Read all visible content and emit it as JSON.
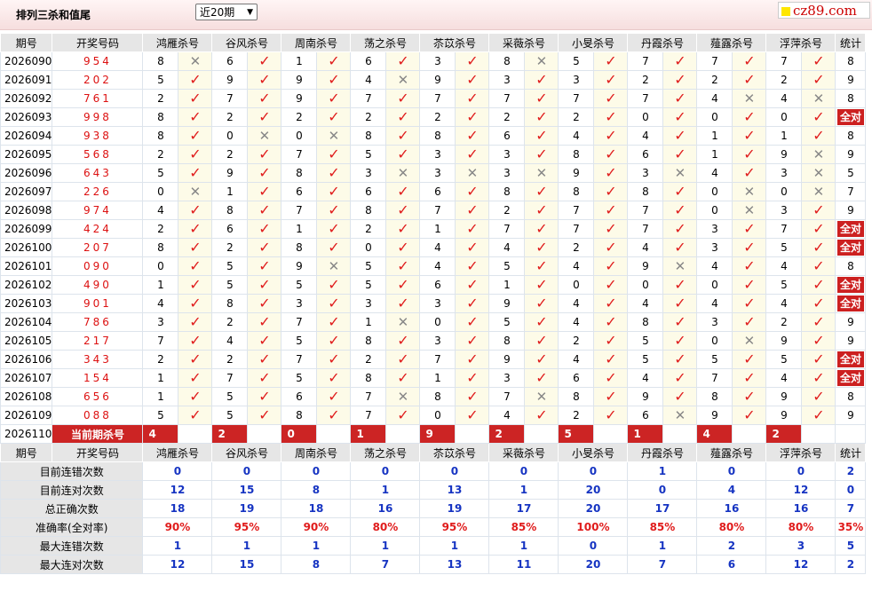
{
  "topbar": {
    "title": "排列三杀和值尾",
    "range_select": "近20期",
    "logo_text": "cz89.com"
  },
  "header": {
    "period": "期号",
    "code": "开奖号码",
    "experts": [
      "鸿雁杀号",
      "谷风杀号",
      "周南杀号",
      "荡之杀号",
      "苶苡杀号",
      "采薇杀号",
      "小旻杀号",
      "丹霞杀号",
      "薤露杀号",
      "浮萍杀号"
    ],
    "stat": "统计"
  },
  "rows": [
    {
      "period": "2026090",
      "code": "954",
      "cells": [
        [
          8,
          0
        ],
        [
          6,
          1
        ],
        [
          1,
          1
        ],
        [
          6,
          1
        ],
        [
          3,
          1
        ],
        [
          8,
          0
        ],
        [
          5,
          1
        ],
        [
          7,
          1
        ],
        [
          7,
          1
        ],
        [
          7,
          1
        ]
      ],
      "stat": "8"
    },
    {
      "period": "2026091",
      "code": "202",
      "cells": [
        [
          5,
          1
        ],
        [
          9,
          1
        ],
        [
          9,
          1
        ],
        [
          4,
          0
        ],
        [
          9,
          1
        ],
        [
          3,
          1
        ],
        [
          3,
          1
        ],
        [
          2,
          1
        ],
        [
          2,
          1
        ],
        [
          2,
          1
        ]
      ],
      "stat": "9"
    },
    {
      "period": "2026092",
      "code": "761",
      "cells": [
        [
          2,
          1
        ],
        [
          7,
          1
        ],
        [
          9,
          1
        ],
        [
          7,
          1
        ],
        [
          7,
          1
        ],
        [
          7,
          1
        ],
        [
          7,
          1
        ],
        [
          7,
          1
        ],
        [
          4,
          0
        ],
        [
          4,
          0
        ]
      ],
      "stat": "8"
    },
    {
      "period": "2026093",
      "code": "998",
      "cells": [
        [
          8,
          1
        ],
        [
          2,
          1
        ],
        [
          2,
          1
        ],
        [
          2,
          1
        ],
        [
          2,
          1
        ],
        [
          2,
          1
        ],
        [
          2,
          1
        ],
        [
          0,
          1
        ],
        [
          0,
          1
        ],
        [
          0,
          1
        ]
      ],
      "stat": "全对"
    },
    {
      "period": "2026094",
      "code": "938",
      "cells": [
        [
          8,
          1
        ],
        [
          0,
          0
        ],
        [
          0,
          0
        ],
        [
          8,
          1
        ],
        [
          8,
          1
        ],
        [
          6,
          1
        ],
        [
          4,
          1
        ],
        [
          4,
          1
        ],
        [
          1,
          1
        ],
        [
          1,
          1
        ]
      ],
      "stat": "8"
    },
    {
      "period": "2026095",
      "code": "568",
      "cells": [
        [
          2,
          1
        ],
        [
          2,
          1
        ],
        [
          7,
          1
        ],
        [
          5,
          1
        ],
        [
          3,
          1
        ],
        [
          3,
          1
        ],
        [
          8,
          1
        ],
        [
          6,
          1
        ],
        [
          1,
          1
        ],
        [
          9,
          0
        ]
      ],
      "stat": "9"
    },
    {
      "period": "2026096",
      "code": "643",
      "cells": [
        [
          5,
          1
        ],
        [
          9,
          1
        ],
        [
          8,
          1
        ],
        [
          3,
          0
        ],
        [
          3,
          0
        ],
        [
          3,
          0
        ],
        [
          9,
          1
        ],
        [
          3,
          0
        ],
        [
          4,
          1
        ],
        [
          3,
          0
        ]
      ],
      "stat": "5"
    },
    {
      "period": "2026097",
      "code": "226",
      "cells": [
        [
          0,
          0
        ],
        [
          1,
          1
        ],
        [
          6,
          1
        ],
        [
          6,
          1
        ],
        [
          6,
          1
        ],
        [
          8,
          1
        ],
        [
          8,
          1
        ],
        [
          8,
          1
        ],
        [
          0,
          0
        ],
        [
          0,
          0
        ]
      ],
      "stat": "7"
    },
    {
      "period": "2026098",
      "code": "974",
      "cells": [
        [
          4,
          1
        ],
        [
          8,
          1
        ],
        [
          7,
          1
        ],
        [
          8,
          1
        ],
        [
          7,
          1
        ],
        [
          2,
          1
        ],
        [
          7,
          1
        ],
        [
          7,
          1
        ],
        [
          0,
          0
        ],
        [
          3,
          1
        ]
      ],
      "stat": "9"
    },
    {
      "period": "2026099",
      "code": "424",
      "cells": [
        [
          2,
          1
        ],
        [
          6,
          1
        ],
        [
          1,
          1
        ],
        [
          2,
          1
        ],
        [
          1,
          1
        ],
        [
          7,
          1
        ],
        [
          7,
          1
        ],
        [
          7,
          1
        ],
        [
          3,
          1
        ],
        [
          7,
          1
        ]
      ],
      "stat": "全对"
    },
    {
      "period": "2026100",
      "code": "207",
      "cells": [
        [
          8,
          1
        ],
        [
          2,
          1
        ],
        [
          8,
          1
        ],
        [
          0,
          1
        ],
        [
          4,
          1
        ],
        [
          4,
          1
        ],
        [
          2,
          1
        ],
        [
          4,
          1
        ],
        [
          3,
          1
        ],
        [
          5,
          1
        ]
      ],
      "stat": "全对"
    },
    {
      "period": "2026101",
      "code": "090",
      "cells": [
        [
          0,
          1
        ],
        [
          5,
          1
        ],
        [
          9,
          0
        ],
        [
          5,
          1
        ],
        [
          4,
          1
        ],
        [
          5,
          1
        ],
        [
          4,
          1
        ],
        [
          9,
          0
        ],
        [
          4,
          1
        ],
        [
          4,
          1
        ]
      ],
      "stat": "8"
    },
    {
      "period": "2026102",
      "code": "490",
      "cells": [
        [
          1,
          1
        ],
        [
          5,
          1
        ],
        [
          5,
          1
        ],
        [
          5,
          1
        ],
        [
          6,
          1
        ],
        [
          1,
          1
        ],
        [
          0,
          1
        ],
        [
          0,
          1
        ],
        [
          0,
          1
        ],
        [
          5,
          1
        ]
      ],
      "stat": "全对"
    },
    {
      "period": "2026103",
      "code": "901",
      "cells": [
        [
          4,
          1
        ],
        [
          8,
          1
        ],
        [
          3,
          1
        ],
        [
          3,
          1
        ],
        [
          3,
          1
        ],
        [
          9,
          1
        ],
        [
          4,
          1
        ],
        [
          4,
          1
        ],
        [
          4,
          1
        ],
        [
          4,
          1
        ]
      ],
      "stat": "全对"
    },
    {
      "period": "2026104",
      "code": "786",
      "cells": [
        [
          3,
          1
        ],
        [
          2,
          1
        ],
        [
          7,
          1
        ],
        [
          1,
          0
        ],
        [
          0,
          1
        ],
        [
          5,
          1
        ],
        [
          4,
          1
        ],
        [
          8,
          1
        ],
        [
          3,
          1
        ],
        [
          2,
          1
        ]
      ],
      "stat": "9"
    },
    {
      "period": "2026105",
      "code": "217",
      "cells": [
        [
          7,
          1
        ],
        [
          4,
          1
        ],
        [
          5,
          1
        ],
        [
          8,
          1
        ],
        [
          3,
          1
        ],
        [
          8,
          1
        ],
        [
          2,
          1
        ],
        [
          5,
          1
        ],
        [
          0,
          0
        ],
        [
          9,
          1
        ]
      ],
      "stat": "9"
    },
    {
      "period": "2026106",
      "code": "343",
      "cells": [
        [
          2,
          1
        ],
        [
          2,
          1
        ],
        [
          7,
          1
        ],
        [
          2,
          1
        ],
        [
          7,
          1
        ],
        [
          9,
          1
        ],
        [
          4,
          1
        ],
        [
          5,
          1
        ],
        [
          5,
          1
        ],
        [
          5,
          1
        ]
      ],
      "stat": "全对"
    },
    {
      "period": "2026107",
      "code": "154",
      "cells": [
        [
          1,
          1
        ],
        [
          7,
          1
        ],
        [
          5,
          1
        ],
        [
          8,
          1
        ],
        [
          1,
          1
        ],
        [
          3,
          1
        ],
        [
          6,
          1
        ],
        [
          4,
          1
        ],
        [
          7,
          1
        ],
        [
          4,
          1
        ]
      ],
      "stat": "全对"
    },
    {
      "period": "2026108",
      "code": "656",
      "cells": [
        [
          1,
          1
        ],
        [
          5,
          1
        ],
        [
          6,
          1
        ],
        [
          7,
          0
        ],
        [
          8,
          1
        ],
        [
          7,
          0
        ],
        [
          8,
          1
        ],
        [
          9,
          1
        ],
        [
          8,
          1
        ],
        [
          9,
          1
        ]
      ],
      "stat": "8"
    },
    {
      "period": "2026109",
      "code": "088",
      "cells": [
        [
          5,
          1
        ],
        [
          5,
          1
        ],
        [
          8,
          1
        ],
        [
          7,
          1
        ],
        [
          0,
          1
        ],
        [
          4,
          1
        ],
        [
          2,
          1
        ],
        [
          6,
          0
        ],
        [
          9,
          1
        ],
        [
          9,
          1
        ]
      ],
      "stat": "9"
    }
  ],
  "current": {
    "period": "2026110",
    "label": "当前期杀号",
    "values": [
      "4",
      "2",
      "0",
      "1",
      "9",
      "2",
      "5",
      "1",
      "4",
      "2"
    ]
  },
  "stats_header": {
    "period": "期号",
    "code": "开奖号码",
    "stat": "统计"
  },
  "stats": [
    {
      "label": "目前连错次数",
      "values": [
        "0",
        "0",
        "0",
        "0",
        "0",
        "0",
        "0",
        "1",
        "0",
        "0"
      ],
      "stat": "2",
      "style": "blue"
    },
    {
      "label": "目前连对次数",
      "values": [
        "12",
        "15",
        "8",
        "1",
        "13",
        "1",
        "20",
        "0",
        "4",
        "12"
      ],
      "stat": "0",
      "style": "blue"
    },
    {
      "label": "总正确次数",
      "values": [
        "18",
        "19",
        "18",
        "16",
        "19",
        "17",
        "20",
        "17",
        "16",
        "16"
      ],
      "stat": "7",
      "style": "blue"
    },
    {
      "label": "准确率(全对率)",
      "values": [
        "90%",
        "95%",
        "90%",
        "80%",
        "95%",
        "85%",
        "100%",
        "85%",
        "80%",
        "80%"
      ],
      "stat": "35%",
      "style": "red"
    },
    {
      "label": "最大连错次数",
      "values": [
        "1",
        "1",
        "1",
        "1",
        "1",
        "1",
        "0",
        "1",
        "2",
        "3"
      ],
      "stat": "5",
      "style": "blue"
    },
    {
      "label": "最大连对次数",
      "values": [
        "12",
        "15",
        "8",
        "7",
        "13",
        "11",
        "20",
        "7",
        "6",
        "12"
      ],
      "stat": "2",
      "style": "blue"
    }
  ],
  "marks": {
    "hit": "✓",
    "miss": "✕",
    "all_correct": "全对"
  },
  "colors": {
    "accent_red": "#cc2020",
    "stat_blue": "#1634c2",
    "code_red": "#dd1111"
  }
}
